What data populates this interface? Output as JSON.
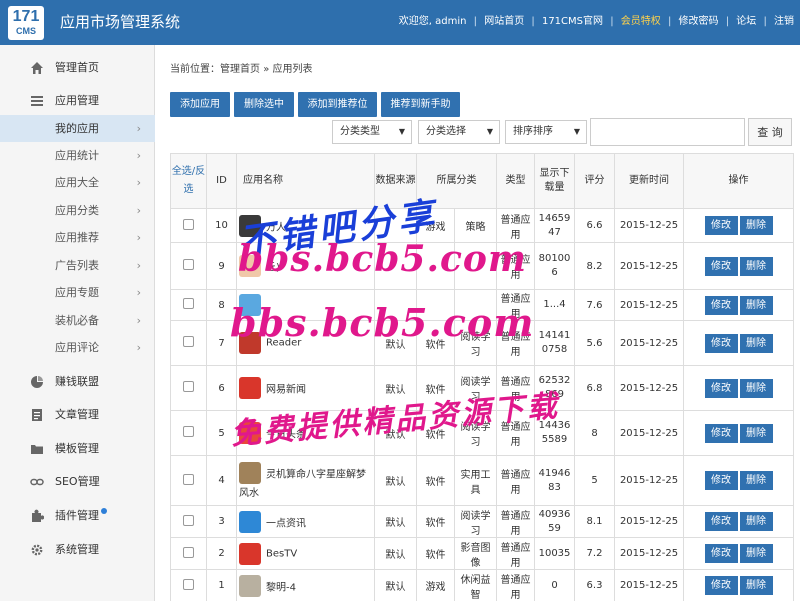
{
  "header": {
    "logo_number": "171",
    "logo_text": "CMS",
    "title": "应用市场管理系统",
    "welcome": "欢迎您, admin",
    "links": [
      "网站首页",
      "171CMS官网",
      "会员特权",
      "修改密码",
      "论坛",
      "注销"
    ]
  },
  "sidebar": {
    "sections": [
      {
        "label": "管理首页",
        "icon": "home-icon"
      },
      {
        "label": "应用管理",
        "icon": "list-icon"
      },
      {
        "label": "赚钱联盟",
        "icon": "pie-chart-icon"
      },
      {
        "label": "文章管理",
        "icon": "document-icon"
      },
      {
        "label": "模板管理",
        "icon": "folder-icon"
      },
      {
        "label": "SEO管理",
        "icon": "link-icon"
      },
      {
        "label": "插件管理",
        "icon": "puzzle-icon"
      },
      {
        "label": "系统管理",
        "icon": "gear-icon"
      }
    ],
    "app_sub_items": [
      "我的应用",
      "应用统计",
      "应用大全",
      "应用分类",
      "应用推荐",
      "广告列表",
      "应用专题",
      "装机必备",
      "应用评论"
    ],
    "active_sub_item": "我的应用"
  },
  "breadcrumb": {
    "prefix": "当前位置：",
    "home": "管理首页",
    "separator": "»",
    "current": "应用列表"
  },
  "toolbar": {
    "buttons": [
      "添加应用",
      "删除选中",
      "添加到推荐位",
      "推荐到新手助"
    ],
    "filters": [
      "分类类型",
      "分类选择",
      "排序排序"
    ],
    "search_label": "查 询"
  },
  "table": {
    "headers": [
      "全选/反选",
      "ID",
      "应用名称",
      "数据来源",
      "所属分类",
      "类型",
      "显示下载量",
      "评分",
      "更新时间",
      "操作"
    ],
    "actions": {
      "edit": "修改",
      "delete": "删除"
    },
    "rows": [
      {
        "id": "10",
        "name": "万人...",
        "source": "",
        "category1": "游戏",
        "category2": "策略",
        "type": "普通应用",
        "downloads": "1465947",
        "rating": "6.6",
        "date": "2015-12-25",
        "icon_color": "#3a3a3a"
      },
      {
        "id": "9",
        "name": "丘)",
        "source": "",
        "category1": "",
        "category2": "",
        "type": "普通应用",
        "downloads": "801006",
        "rating": "8.2",
        "date": "2015-12-25",
        "icon_color": "#f0c8a8"
      },
      {
        "id": "8",
        "name": "",
        "source": "",
        "category1": "",
        "category2": "",
        "type": "普通应用",
        "downloads": "1...4",
        "rating": "7.6",
        "date": "2015-12-25",
        "icon_color": "#5aa8e0"
      },
      {
        "id": "7",
        "name": "Reader",
        "source": "默认",
        "category1": "软件",
        "category2": "阅读学习",
        "type": "普通应用",
        "downloads": "141410758",
        "rating": "5.6",
        "date": "2015-12-25",
        "icon_color": "#c0392b"
      },
      {
        "id": "6",
        "name": "网易新闻",
        "source": "默认",
        "category1": "软件",
        "category2": "阅读学习",
        "type": "普通应用",
        "downloads": "62532869",
        "rating": "6.8",
        "date": "2015-12-25",
        "icon_color": "#d9362b"
      },
      {
        "id": "5",
        "name": "今日头条",
        "source": "默认",
        "category1": "软件",
        "category2": "阅读学习",
        "type": "普通应用",
        "downloads": "144365589",
        "rating": "8",
        "date": "2015-12-25",
        "icon_color": "#e8483a"
      },
      {
        "id": "4",
        "name": "灵机算命八字星座解梦风水",
        "source": "默认",
        "category1": "软件",
        "category2": "实用工具",
        "type": "普通应用",
        "downloads": "4194683",
        "rating": "5",
        "date": "2015-12-25",
        "icon_color": "#a0825a"
      },
      {
        "id": "3",
        "name": "一点资讯",
        "source": "默认",
        "category1": "软件",
        "category2": "阅读学习",
        "type": "普通应用",
        "downloads": "4093659",
        "rating": "8.1",
        "date": "2015-12-25",
        "icon_color": "#2e88d6"
      },
      {
        "id": "2",
        "name": "BesTV",
        "source": "默认",
        "category1": "软件",
        "category2": "影音图像",
        "type": "普通应用",
        "downloads": "10035",
        "rating": "7.2",
        "date": "2015-12-25",
        "icon_color": "#d9362b"
      },
      {
        "id": "1",
        "name": "黎明-4",
        "source": "默认",
        "category1": "游戏",
        "category2": "休闲益智",
        "type": "普通应用",
        "downloads": "0",
        "rating": "6.3",
        "date": "2015-12-25",
        "icon_color": "#b8b0a0"
      }
    ]
  },
  "watermark": {
    "line1": "不错吧分享",
    "line2": "bbs.bcb5.com",
    "line3": "bbs.bcb5.com",
    "line4": "免费提供精品资源下载"
  },
  "colors": {
    "header_bg": "#2e6fad",
    "button_bg": "#3071b0",
    "active_item_bg": "#d8e6f3",
    "vip_link": "#ffd24a"
  }
}
